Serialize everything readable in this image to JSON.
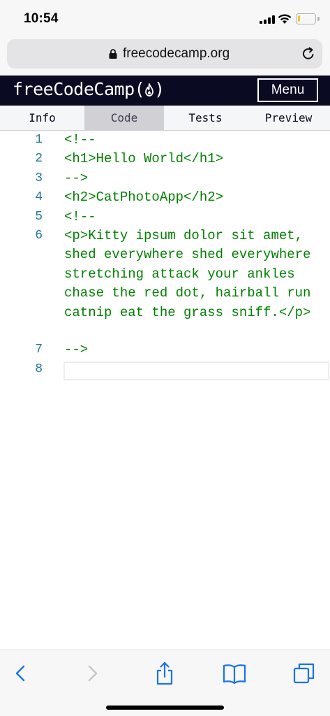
{
  "status_bar": {
    "time": "10:54",
    "battery_level": 0.15,
    "battery_color": "#f7c224"
  },
  "browser": {
    "url": "freecodecamp.org"
  },
  "navbar": {
    "logo_text": "freeCodeCamp(",
    "logo_text_end": ")",
    "menu_label": "Menu",
    "background": "#0a0a23"
  },
  "tabs": [
    {
      "label": "Info",
      "active": false
    },
    {
      "label": "Code",
      "active": true
    },
    {
      "label": "Tests",
      "active": false
    },
    {
      "label": "Preview",
      "active": false
    }
  ],
  "editor": {
    "lines": [
      {
        "number": "1",
        "text": "<!--"
      },
      {
        "number": "2",
        "text": "<h1>Hello World</h1>"
      },
      {
        "number": "3",
        "text": "-->"
      },
      {
        "number": "4",
        "text": "<h2>CatPhotoApp</h2>"
      },
      {
        "number": "5",
        "text": "<!--"
      },
      {
        "number": "6",
        "text": "<p>Kitty ipsum dolor sit amet, shed everywhere shed everywhere stretching attack your ankles chase the red dot, hairball run catnip eat the grass sniff.</p>"
      },
      {
        "number": "7",
        "text": "-->"
      },
      {
        "number": "8",
        "text": ""
      }
    ],
    "code_color": "#008000",
    "line_number_color": "#237893"
  },
  "toolbar": {
    "icons": [
      "back-icon",
      "forward-icon",
      "share-icon",
      "bookmarks-icon",
      "tabs-icon"
    ],
    "accent": "#1a73e8"
  }
}
